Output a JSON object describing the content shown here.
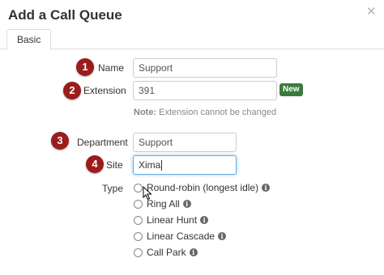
{
  "dialog": {
    "title": "Add a Call Queue",
    "close_icon": "close-icon"
  },
  "tabs": [
    {
      "label": "Basic"
    }
  ],
  "steps": [
    "1",
    "2",
    "3",
    "4"
  ],
  "form": {
    "name": {
      "label": "Name",
      "value": "Support"
    },
    "extension": {
      "label": "Extension",
      "value": "391",
      "badge": "New",
      "note_bold": "Note:",
      "note_text": " Extension cannot be changed"
    },
    "department": {
      "label": "Department",
      "value": "Support"
    },
    "site": {
      "label": "Site",
      "value": "Xima"
    },
    "type": {
      "label": "Type",
      "options": [
        "Round-robin (longest idle)",
        "Ring All",
        "Linear Hunt",
        "Linear Cascade",
        "Call Park"
      ]
    }
  },
  "colors": {
    "step_badge": "#9b1c1c",
    "new_badge": "#3b7a3d",
    "focus_border": "#66afe9"
  }
}
